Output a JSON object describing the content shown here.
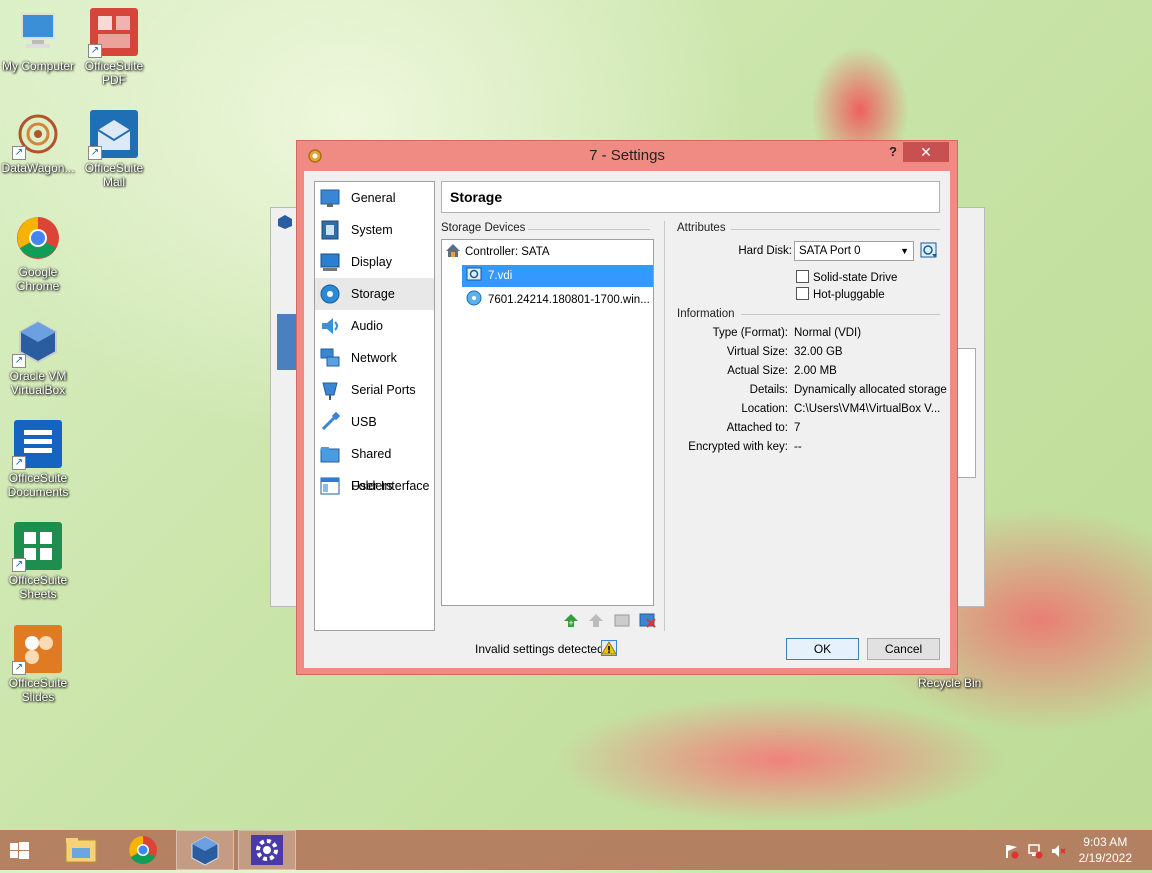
{
  "desktop": {
    "icons": [
      {
        "label": "My Computer",
        "icon": "computer-icon"
      },
      {
        "label": "OfficeSuite PDF",
        "icon": "pdf-icon"
      },
      {
        "label": "DataWagon...",
        "icon": "datawagon-icon"
      },
      {
        "label": "OfficeSuite Mail",
        "icon": "mail-icon"
      },
      {
        "label": "Google Chrome",
        "icon": "chrome-icon"
      },
      {
        "label": "Oracle VM VirtualBox",
        "icon": "virtualbox-icon"
      },
      {
        "label": "OfficeSuite Documents",
        "icon": "documents-icon"
      },
      {
        "label": "OfficeSuite Sheets",
        "icon": "sheets-icon"
      },
      {
        "label": "OfficeSuite Slides",
        "icon": "slides-icon"
      }
    ],
    "recycle_bin": "Recycle Bin"
  },
  "dialog": {
    "title": "7 - Settings",
    "help": "?",
    "close": "✕",
    "nav": [
      {
        "label": "General",
        "icon": "general-icon"
      },
      {
        "label": "System",
        "icon": "system-icon"
      },
      {
        "label": "Display",
        "icon": "display-icon"
      },
      {
        "label": "Storage",
        "icon": "storage-icon",
        "selected": true
      },
      {
        "label": "Audio",
        "icon": "audio-icon"
      },
      {
        "label": "Network",
        "icon": "network-icon"
      },
      {
        "label": "Serial Ports",
        "icon": "serial-ports-icon"
      },
      {
        "label": "USB",
        "icon": "usb-icon"
      },
      {
        "label": "Shared Folders",
        "icon": "shared-folders-icon"
      },
      {
        "label": "User Interface",
        "icon": "user-interface-icon"
      }
    ],
    "page_title": "Storage",
    "storage_devices_label": "Storage Devices",
    "tree": {
      "controller": "Controller: SATA",
      "disk": "7.vdi",
      "optical": "7601.24214.180801-1700.win..."
    },
    "attributes_label": "Attributes",
    "hard_disk_label": "Hard Disk:",
    "hard_disk_value": "SATA Port 0",
    "ssd_label": "Solid-state Drive",
    "hotplug_label": "Hot-pluggable",
    "information_label": "Information",
    "info": [
      {
        "key": "Type (Format):",
        "value": "Normal (VDI)"
      },
      {
        "key": "Virtual Size:",
        "value": "32.00 GB"
      },
      {
        "key": "Actual Size:",
        "value": "2.00 MB"
      },
      {
        "key": "Details:",
        "value": "Dynamically allocated storage"
      },
      {
        "key": "Location:",
        "value": "C:\\Users\\VM4\\VirtualBox V..."
      },
      {
        "key": "Attached to:",
        "value": "7"
      },
      {
        "key": "Encrypted with key:",
        "value": "--"
      }
    ],
    "status": "Invalid settings detected",
    "ok": "OK",
    "cancel": "Cancel"
  },
  "taskbar": {
    "time": "9:03 AM",
    "date": "2/19/2022"
  },
  "colors": {
    "dialog_frame": "#f08b83",
    "selection": "#3399ff",
    "close_button": "#c75050",
    "taskbar": "#b2785c"
  }
}
